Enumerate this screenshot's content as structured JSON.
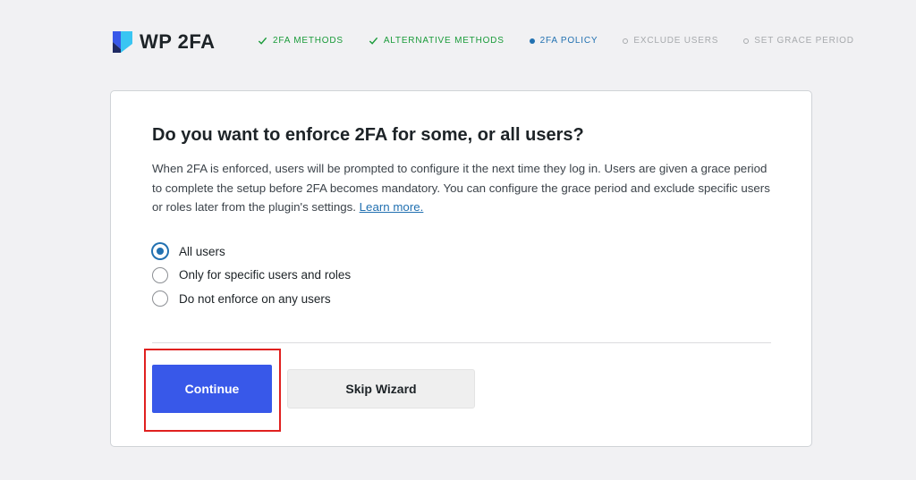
{
  "brand": {
    "name": "WP 2FA",
    "color": "#3858e9"
  },
  "steps": [
    {
      "label": "2FA METHODS",
      "state": "done"
    },
    {
      "label": "ALTERNATIVE METHODS",
      "state": "done"
    },
    {
      "label": "2FA POLICY",
      "state": "current"
    },
    {
      "label": "EXCLUDE USERS",
      "state": "todo"
    },
    {
      "label": "SET GRACE PERIOD",
      "state": "todo"
    }
  ],
  "card": {
    "title": "Do you want to enforce 2FA for some, or all users?",
    "description": "When 2FA is enforced, users will be prompted to configure it the next time they log in. Users are given a grace period to complete the setup before 2FA becomes mandatory. You can configure the grace period and exclude specific users or roles later from the plugin's settings.",
    "learn_more": "Learn more.",
    "options": [
      {
        "label": "All users",
        "checked": true
      },
      {
        "label": "Only for specific users and roles",
        "checked": false
      },
      {
        "label": "Do not enforce on any users",
        "checked": false
      }
    ],
    "continue_label": "Continue",
    "skip_label": "Skip Wizard"
  }
}
